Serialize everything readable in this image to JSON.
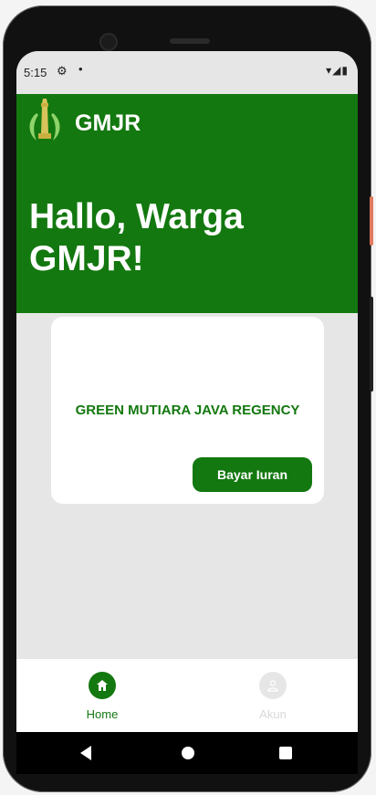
{
  "status": {
    "time": "5:15",
    "settings_icon": "gear-icon",
    "notification_dot": "•",
    "right_icons": "▾◢▮"
  },
  "header": {
    "brand": "GMJR",
    "greeting": "Hallo, Warga GMJR!",
    "logo_icon": "monument-icon",
    "color": "#13780f"
  },
  "card": {
    "title": "GREEN MUTIARA JAVA REGENCY",
    "button_label": "Bayar Iuran"
  },
  "bottom_nav": {
    "items": [
      {
        "label": "Home",
        "icon": "home-icon",
        "active": true
      },
      {
        "label": "Akun",
        "icon": "person-icon",
        "active": false
      }
    ]
  },
  "system_nav": {
    "back_icon": "back-icon",
    "home_icon": "home-circle-icon",
    "recent_icon": "recent-apps-icon"
  }
}
